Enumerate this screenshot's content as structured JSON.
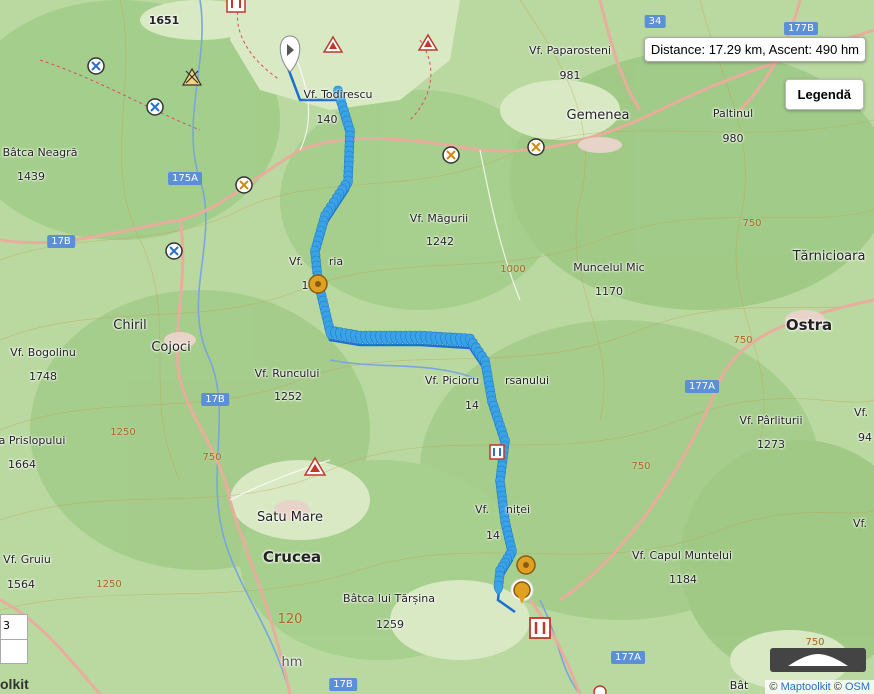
{
  "distance_box": {
    "text": "Distance: 17.29 km, Ascent: 490 hm"
  },
  "legend_button": {
    "label": "Legendă"
  },
  "attribution": {
    "prefix": "© ",
    "link1": "Maptoolkit",
    "middle": " © ",
    "link2": "OSM"
  },
  "logo_fragment": "olkit",
  "zoom_fragment": {
    "plus": "3",
    "minus": ""
  },
  "places": {
    "top_alt": "1651",
    "paparosteni_name": "Vf. Paparosteni",
    "paparosteni_alt": "981",
    "gemenea": "Gemenea",
    "paltinul_name": "Paltinul",
    "paltinul_alt": "980",
    "todirescu_name": "Vf. Todirescu",
    "todirescu_alt": "140",
    "batca_neagra_name": "Bâtca Neagră",
    "batca_neagra_alt": "1439",
    "magurii_name": "Vf. Măgurii",
    "magurii_alt": "1242",
    "tarnicioara": "Tărnicioara",
    "muncelul_name": "Muncelul Mic",
    "muncelul_alt": "1170",
    "vf_left_name": "Vf.",
    "vf_left_suffix": "ria",
    "vf_left_alt": "1",
    "chiril": "Chiril",
    "cojoci": "Cojoci",
    "ostra": "Ostra",
    "bogolinu_name": "Vf. Bogolinu",
    "bogolinu_alt": "1748",
    "runcului_name": "Vf. Runcului",
    "runcului_alt": "1252",
    "picioru_name": "Vf. Picioru",
    "picioru_suffix": "rsanului",
    "picioru_alt": "14",
    "parlituri_name": "Vf. Pârliturii",
    "parlituri_alt": "1273",
    "vf_right_name": "Vf.",
    "vf_right_alt": "94",
    "prislopului_name": "a Prislopului",
    "prislopului_alt": "1664",
    "satu_mare": "Satu Mare",
    "crucea": "Crucea",
    "vf_nitei_name": "Vf.",
    "vf_nitei_suffix": "niței",
    "vf_nitei_alt": "14",
    "capul_name": "Vf. Capul Muntelui",
    "capul_alt": "1184",
    "gruiu_name": "Vf. Gruiu",
    "gruiu_alt": "1564",
    "batca_tarsina_name": "Bâtca lui Tărșina",
    "batca_tarsina_alt": "1259",
    "bat_fragment": "Bât",
    "vf_far_right_name": "Vf.",
    "unit_fragment": "hm",
    "contour_1200_fragment": "120"
  },
  "roads": {
    "r34": "34",
    "r177b_top": "177B",
    "r175a": "175A",
    "r17b_left": "17B",
    "r17b_mid": "17B",
    "r177a_right": "177A",
    "r177a_bottom": "177A",
    "r17b_bottom": "17B"
  },
  "contours": {
    "c750_a": "750",
    "c1000": "1000",
    "c750_b": "750",
    "c1250_a": "1250",
    "c750_c": "750",
    "c1250_b": "1250",
    "c750_d": "750",
    "c750_e": "750"
  },
  "colors": {
    "forest": "#a7cf8f",
    "meadow": "#cfe3b8",
    "route": "#2f8fe0",
    "route_marker": "#3aa3e8",
    "waypoint": "#e0a020",
    "road": "#e8ad9c",
    "river": "#7aa6de"
  }
}
